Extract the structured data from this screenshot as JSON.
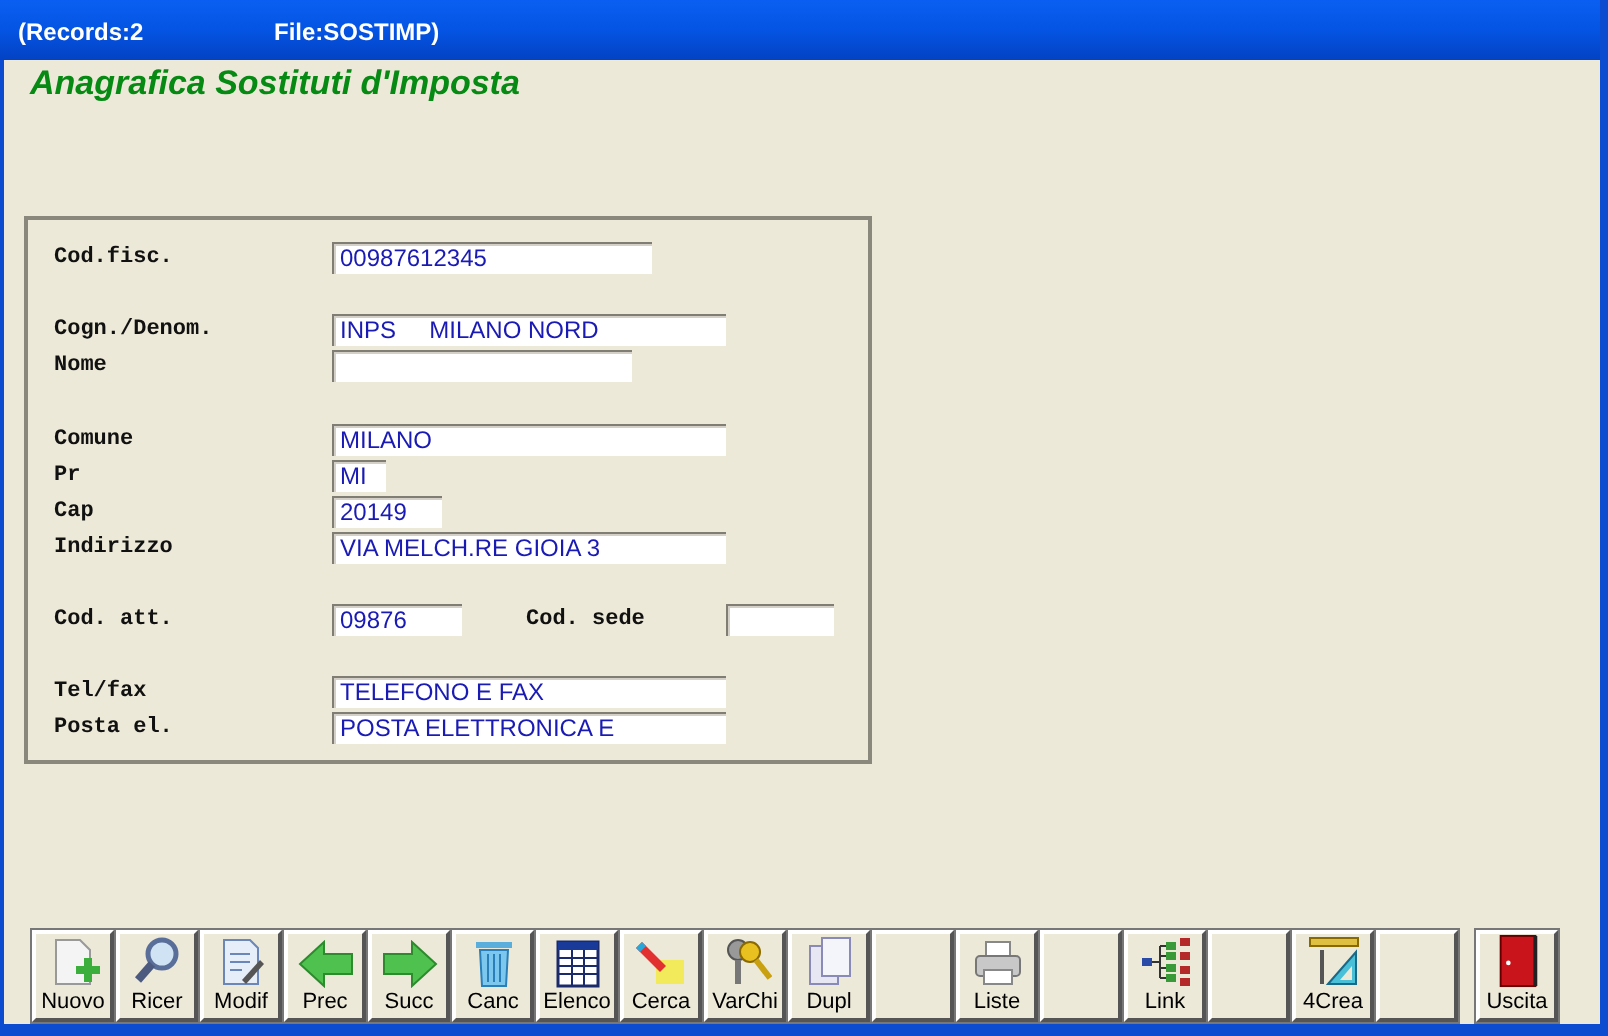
{
  "title_bar": {
    "records": "(Records:2",
    "file": "File:SOSTIMP)"
  },
  "heading": "Anagrafica Sostituti d'Imposta",
  "form": {
    "rows": [
      {
        "fields": [
          {
            "label": "Cod.fisc.",
            "value": "00987612345"
          }
        ]
      },
      {
        "fields": [
          {
            "label": "Cogn./Denom.",
            "value": "INPS     MILANO NORD"
          }
        ]
      },
      {
        "fields": [
          {
            "label": "Nome"
          }
        ]
      },
      {
        "fields": [
          {
            "label": "Comune",
            "value": "MILANO"
          }
        ]
      },
      {
        "fields": [
          {
            "label": "Pr",
            "value": "MI"
          }
        ]
      },
      {
        "fields": [
          {
            "label": "Cap",
            "value": "20149"
          }
        ]
      },
      {
        "fields": [
          {
            "label": "Indirizzo",
            "value": "VIA MELCH.RE GIOIA 3"
          }
        ]
      },
      {
        "fields": [
          {
            "label": "Cod. att.",
            "value": "09876"
          },
          {
            "label": "Cod. sede"
          }
        ]
      },
      {
        "fields": [
          {
            "label": "Tel/fax",
            "value": "TELEFONO E FAX"
          }
        ]
      },
      {
        "fields": [
          {
            "label": "Posta el.",
            "value": "POSTA ELETTRONICA E"
          }
        ]
      }
    ]
  },
  "toolbar": [
    {
      "kind": "command",
      "label": "Nuovo"
    },
    {
      "kind": "command",
      "label": "Ricer"
    },
    {
      "kind": "command",
      "label": "Modif"
    },
    {
      "kind": "command",
      "label": "Prec"
    },
    {
      "kind": "command",
      "label": "Succ"
    },
    {
      "kind": "command",
      "label": "Canc"
    },
    {
      "kind": "command",
      "label": "Elenco"
    },
    {
      "kind": "command",
      "label": "Cerca"
    },
    {
      "kind": "command",
      "label": "VarChi"
    },
    {
      "kind": "command",
      "label": "Dupl"
    },
    {
      "kind": "empty"
    },
    {
      "kind": "command",
      "label": "Liste"
    },
    {
      "kind": "empty"
    },
    {
      "kind": "command",
      "label": "Link"
    },
    {
      "kind": "empty"
    },
    {
      "kind": "command",
      "label": "4Crea"
    },
    {
      "kind": "empty"
    },
    {
      "kind": "exit",
      "label": "Uscita"
    }
  ]
}
